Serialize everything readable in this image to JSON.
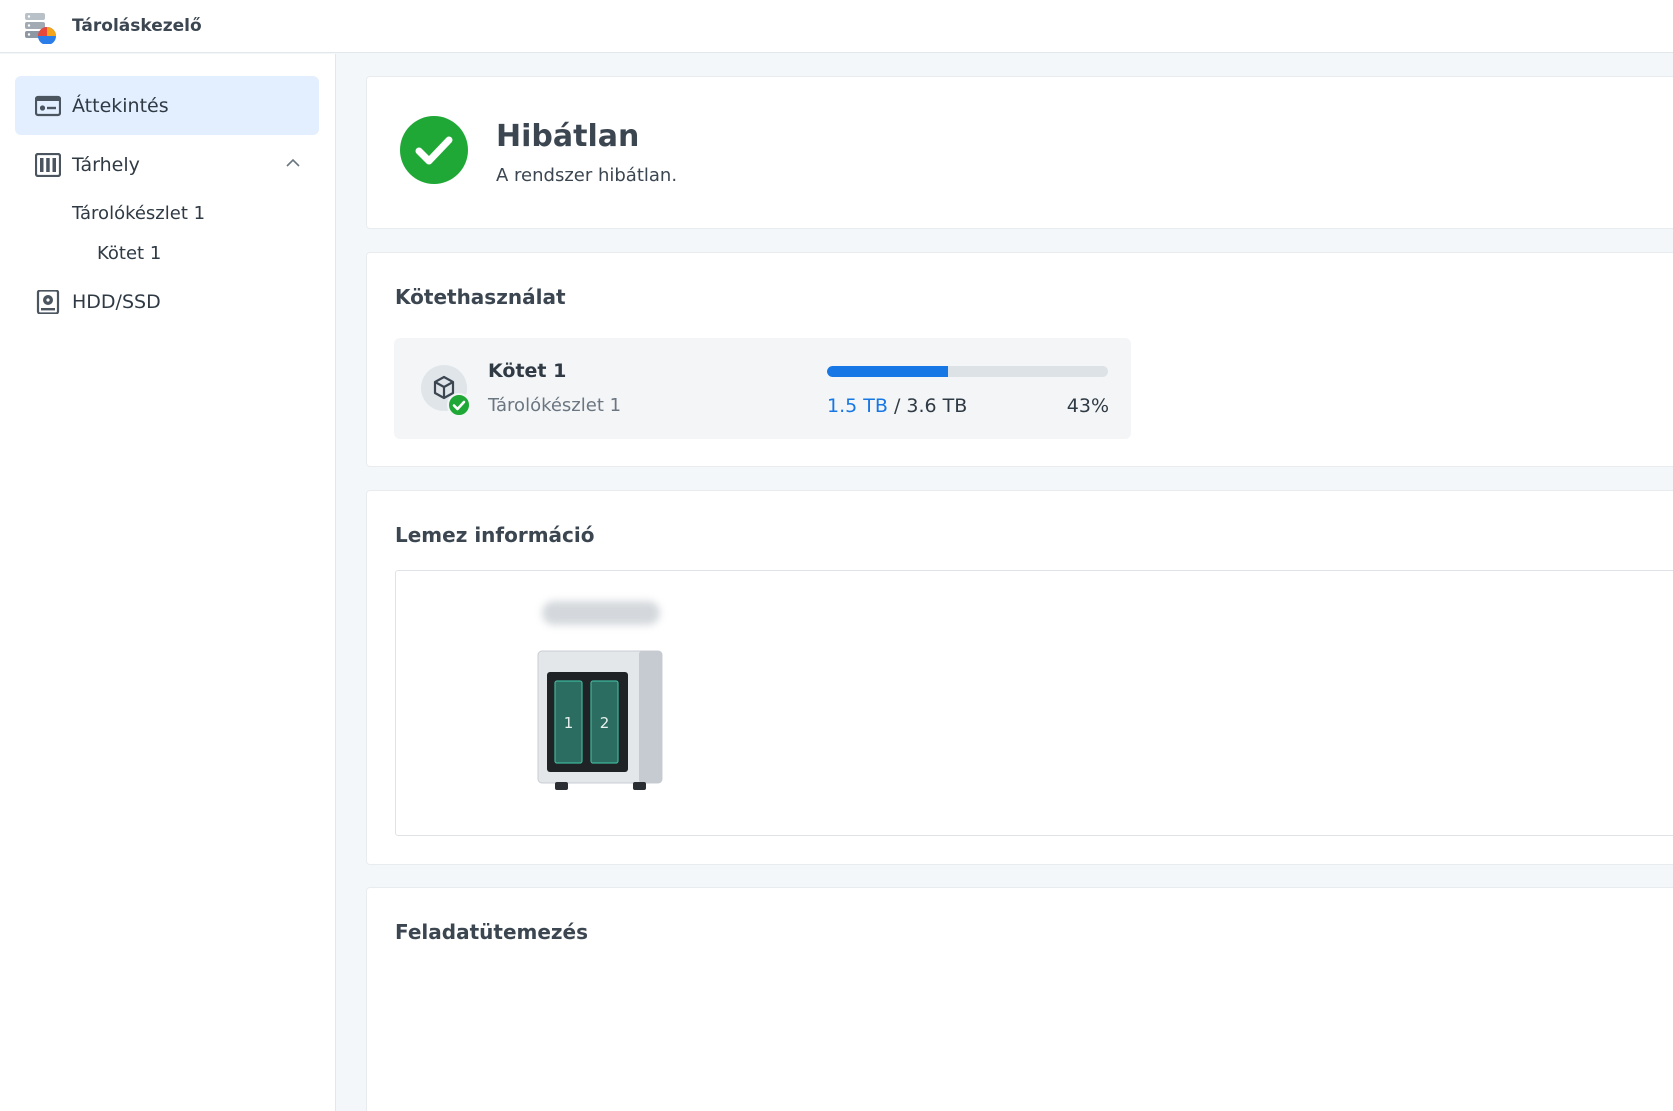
{
  "app": {
    "title": "Tároláskezelő",
    "icon": "storage-manager-icon"
  },
  "sidebar": {
    "items": [
      {
        "label": "Áttekintés",
        "icon": "overview-card-icon",
        "active": true
      },
      {
        "label": "Tárhely",
        "icon": "storage-icon",
        "expanded": true,
        "children": [
          {
            "label": "Tárolókészlet 1",
            "children": [
              {
                "label": "Kötet 1"
              }
            ]
          }
        ]
      },
      {
        "label": "HDD/SSD",
        "icon": "hdd-icon"
      }
    ]
  },
  "status": {
    "title": "Hibátlan",
    "subtitle": "A rendszer hibátlan.",
    "icon": "check-icon",
    "color": "#1fa836"
  },
  "volume_usage": {
    "title": "Kötethasználat",
    "volume": {
      "name": "Kötet 1",
      "pool": "Tárolókészlet 1",
      "used": "1.5 TB",
      "separator": "/",
      "total": "3.6 TB",
      "percent": "43%",
      "fraction": 0.43,
      "icon": "volume-cube-icon"
    },
    "accent": "#1677e5"
  },
  "disk_info": {
    "title": "Lemez információ",
    "bays": [
      "1",
      "2"
    ]
  },
  "task_schedule": {
    "title": "Feladatütemezés"
  }
}
